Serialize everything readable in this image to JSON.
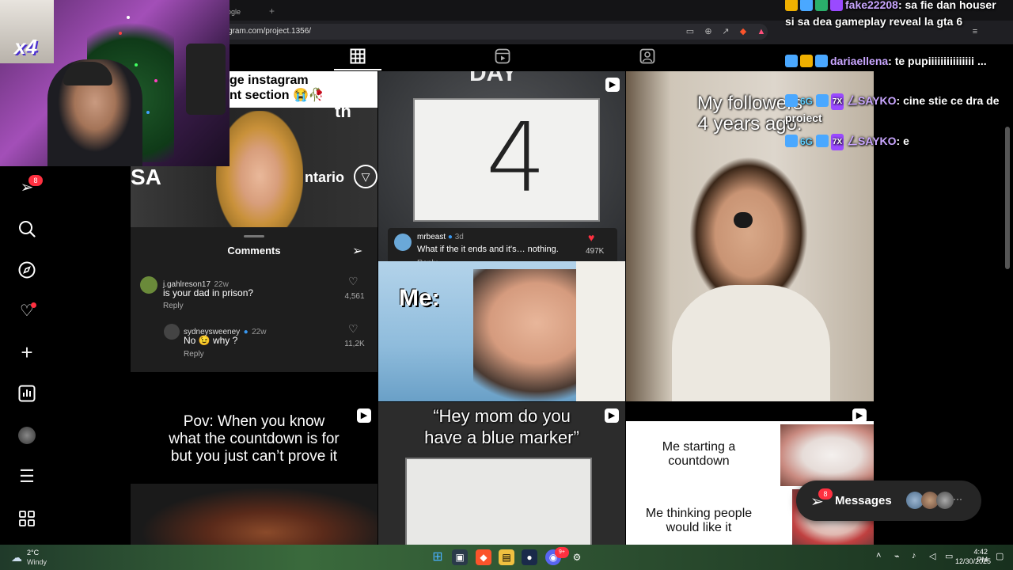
{
  "browser": {
    "tab_title": "ogle",
    "new_tab": "+",
    "url": "gram.com/project.1356/"
  },
  "colors": {
    "accent_red": "#ff3040",
    "chat_name": "#c9a6ff",
    "verified_blue": "#3897f0"
  },
  "sidebar": {
    "notifications_badge": "8"
  },
  "webcam": {
    "overlay_text": "x4"
  },
  "tiles": {
    "tile1": {
      "caption_line1": "ge instagram",
      "caption_line2": "nt section 😭🥀",
      "brand_text_left": "SA",
      "brand_text_right": "ntario",
      "brand_text_top": "th",
      "comments_title": "Comments",
      "comments": [
        {
          "user": "j.gahlreson17",
          "time": "22w",
          "text": "is your dad in prison?",
          "reply": "Reply",
          "likes": "4,561"
        },
        {
          "user": "sydneysweeney",
          "time": "22w",
          "text": "No 😉 why ?",
          "reply": "Reply",
          "likes": "11,2K"
        }
      ]
    },
    "tile2": {
      "top_text": "DAY",
      "board_number": "4",
      "comment_user": "mrbeast",
      "comment_time": "3d",
      "comment_text": "What if the it ends and it's… nothing.",
      "comment_reply": "Reply",
      "comment_likes": "497K",
      "meme_label": "Me:"
    },
    "tile3": {
      "caption_line1": "My followers",
      "caption_line2": "4 years ago:"
    },
    "tile4": {
      "caption_line1": "Pov: When you know",
      "caption_line2": "what the countdown is for",
      "caption_line3": "but you just can’t prove it"
    },
    "tile5": {
      "caption_line1": "“Hey mom do you",
      "caption_line2": "have a blue marker”"
    },
    "tile6": {
      "text1_line1": "Me starting a",
      "text1_line2": "countdown",
      "text2_line1": "Me thinking people",
      "text2_line2": "would like it"
    }
  },
  "chat": [
    {
      "user": "fake22208",
      "message": "sa fie dan houser si sa dea gameplay reveal la gta 6"
    },
    {
      "user": "dariaellena",
      "message": "te pupiiiiiiiiiiiiiii ..."
    },
    {
      "user": "ㄥSAYKO",
      "message": "cine stie ce dra de proiect"
    },
    {
      "user": "ㄥSAYKO",
      "message": "e"
    }
  ],
  "chat_badges": [
    "6G",
    "6G",
    "7X"
  ],
  "messages": {
    "label": "Messages",
    "badge": "8",
    "more": "···"
  },
  "taskbar": {
    "weather_temp": "2°C",
    "weather_desc": "Windy",
    "time": "4:42 PM",
    "date": "12/30/2025",
    "discord_badge": "9+"
  }
}
